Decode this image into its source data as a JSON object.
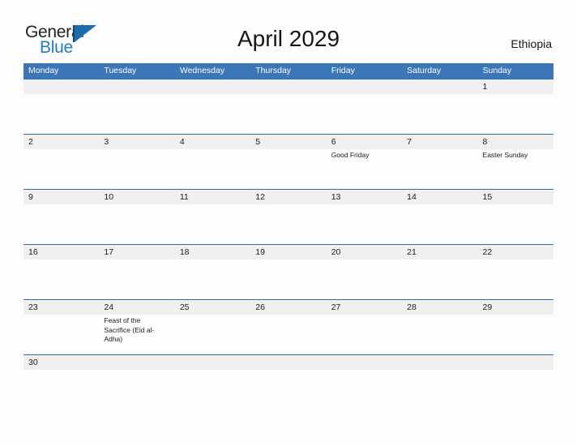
{
  "brand": {
    "word_one": "General",
    "word_two": "Blue",
    "flag_icon": "flag-triangle-icon",
    "accent_color": "#1f7fc4"
  },
  "header": {
    "title": "April 2029",
    "region": "Ethiopia"
  },
  "colors": {
    "header_blue": "#3a76b8",
    "divider_blue": "#2e6daf",
    "date_band_gray": "#f0f0f0",
    "page_background": "#fdfdfd",
    "text": "#1b1b1b"
  },
  "calendar": {
    "month": "April",
    "year": "2029",
    "day_headers": [
      "Monday",
      "Tuesday",
      "Wednesday",
      "Thursday",
      "Friday",
      "Saturday",
      "Sunday"
    ],
    "weeks": [
      {
        "dates": [
          "",
          "",
          "",
          "",
          "",
          "",
          "1"
        ],
        "events": [
          "",
          "",
          "",
          "",
          "",
          "",
          ""
        ]
      },
      {
        "dates": [
          "2",
          "3",
          "4",
          "5",
          "6",
          "7",
          "8"
        ],
        "events": [
          "",
          "",
          "",
          "",
          "Good Friday",
          "",
          "Easter Sunday"
        ]
      },
      {
        "dates": [
          "9",
          "10",
          "11",
          "12",
          "13",
          "14",
          "15"
        ],
        "events": [
          "",
          "",
          "",
          "",
          "",
          "",
          ""
        ]
      },
      {
        "dates": [
          "16",
          "17",
          "18",
          "19",
          "20",
          "21",
          "22"
        ],
        "events": [
          "",
          "",
          "",
          "",
          "",
          "",
          ""
        ]
      },
      {
        "dates": [
          "23",
          "24",
          "25",
          "26",
          "27",
          "28",
          "29"
        ],
        "events": [
          "",
          "Feast of the Sacrifice (Eid al-Adha)",
          "",
          "",
          "",
          "",
          ""
        ]
      },
      {
        "dates": [
          "30",
          "",
          "",
          "",
          "",
          "",
          ""
        ],
        "events": null
      }
    ]
  }
}
